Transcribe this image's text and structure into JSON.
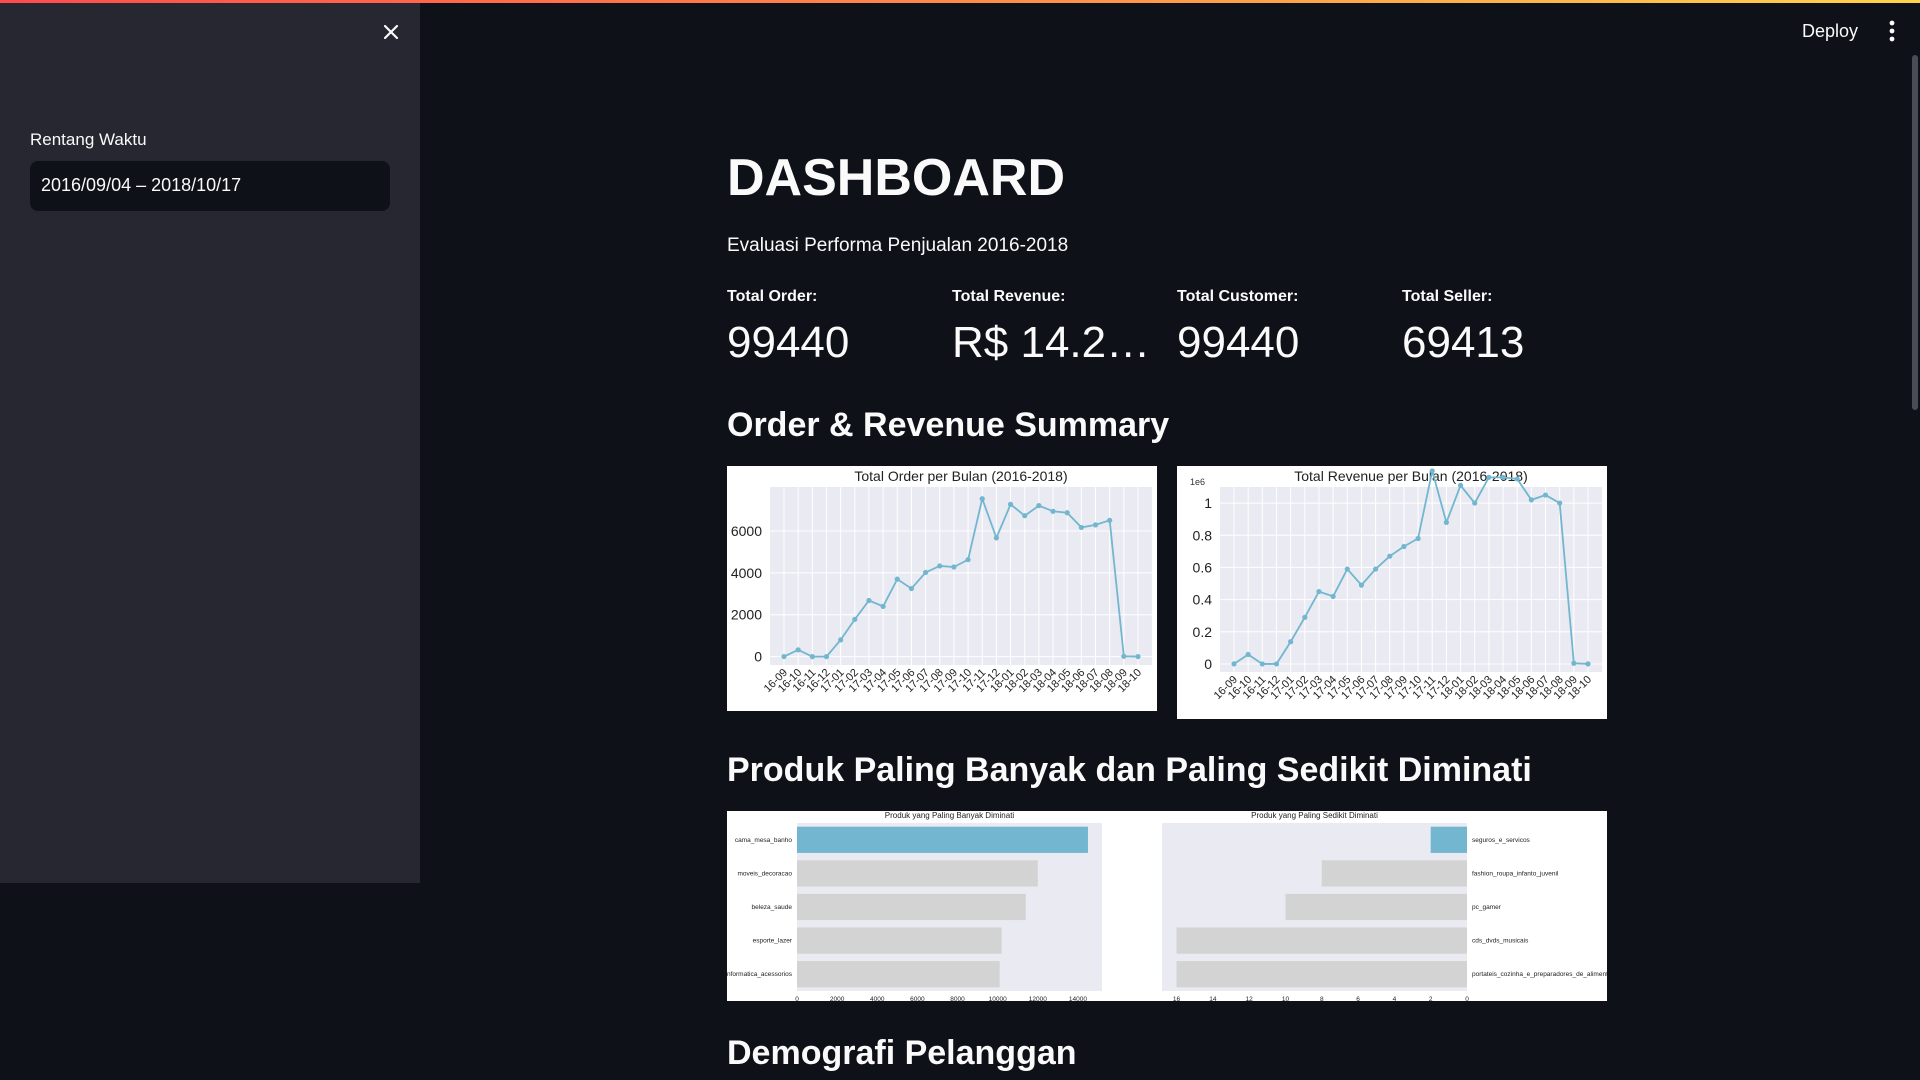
{
  "sidebar": {
    "close_icon": "close-icon",
    "date_label": "Rentang Waktu",
    "date_value": "2016/09/04 – 2018/10/17"
  },
  "header": {
    "deploy_label": "Deploy",
    "menu_icon": "kebab-menu-icon"
  },
  "colors": {
    "accent_gradient": [
      "#ff4b4b",
      "#ffd34b"
    ],
    "series_line": "#72b6cf",
    "bar_highlight": "#72b6cf",
    "bar_muted": "#d3d3d3"
  },
  "main": {
    "title": "DASHBOARD",
    "subtitle": "Evaluasi Performa Penjualan 2016-2018",
    "metrics": [
      {
        "label": "Total Order:",
        "value": "99440"
      },
      {
        "label": "Total Revenue:",
        "value": "R$ 14.20…"
      },
      {
        "label": "Total Customer:",
        "value": "99440"
      },
      {
        "label": "Total Seller:",
        "value": "69413"
      }
    ],
    "section1_title": "Order & Revenue Summary",
    "section2_title": "Produk Paling Banyak dan Paling Sedikit Diminati",
    "section3_title": "Demografi Pelanggan"
  },
  "chart_data": [
    {
      "type": "line",
      "title": "Total Order per Bulan (2016-2018)",
      "x": [
        "16-09",
        "16-10",
        "16-11",
        "16-12",
        "17-01",
        "17-02",
        "17-03",
        "17-04",
        "17-05",
        "17-06",
        "17-07",
        "17-08",
        "17-09",
        "17-10",
        "17-11",
        "17-12",
        "18-01",
        "18-02",
        "18-03",
        "18-04",
        "18-05",
        "18-06",
        "18-07",
        "18-08",
        "18-09",
        "18-10"
      ],
      "values": [
        4,
        324,
        0,
        1,
        800,
        1780,
        2680,
        2400,
        3700,
        3250,
        4020,
        4330,
        4280,
        4630,
        7540,
        5670,
        7270,
        6730,
        7210,
        6940,
        6870,
        6170,
        6290,
        6510,
        16,
        4
      ],
      "yticks": [
        0,
        2000,
        4000,
        6000
      ],
      "ylim": [
        -400,
        8100
      ]
    },
    {
      "type": "line",
      "title": "Total Revenue per Bulan (2016-2018)",
      "scale_label": "1e6",
      "x": [
        "16-09",
        "16-10",
        "16-11",
        "16-12",
        "17-01",
        "17-02",
        "17-03",
        "17-04",
        "17-05",
        "17-06",
        "17-07",
        "17-08",
        "17-09",
        "17-10",
        "17-11",
        "17-12",
        "18-01",
        "18-02",
        "18-03",
        "18-04",
        "18-05",
        "18-06",
        "18-07",
        "18-08",
        "18-09",
        "18-10"
      ],
      "values": [
        0.0003,
        0.059,
        0,
        2e-05,
        0.138,
        0.29,
        0.45,
        0.42,
        0.59,
        0.49,
        0.59,
        0.67,
        0.73,
        0.78,
        1.2,
        0.88,
        1.11,
        1.0,
        1.16,
        1.16,
        1.15,
        1.02,
        1.05,
        1.0,
        0.0045,
        0.0006
      ],
      "values_note_removed": true,
      "yticks": [
        0.0,
        0.2,
        0.4,
        0.6,
        0.8,
        1.0
      ],
      "ylim": [
        -0.05,
        1.1
      ]
    },
    {
      "type": "bar",
      "orientation": "horizontal",
      "title": "Produk yang Paling Banyak Diminati",
      "categories": [
        "cama_mesa_banho",
        "moveis_decoracao",
        "beleza_saude",
        "esporte_lazer",
        "informatica_acessorios"
      ],
      "values": [
        14500,
        12000,
        11400,
        10200,
        10100
      ],
      "xticks": [
        0,
        2000,
        4000,
        6000,
        8000,
        10000,
        12000,
        14000
      ],
      "xlim": [
        0,
        15200
      ]
    },
    {
      "type": "bar",
      "orientation": "horizontal",
      "title": "Produk yang Paling Sedikit Diminati",
      "categories": [
        "seguros_e_servicos",
        "fashion_roupa_infanto_juvenil",
        "pc_gamer",
        "cds_dvds_musicais",
        "portateis_cozinha_e_preparadores_de_alimentos"
      ],
      "values": [
        2,
        8,
        10,
        16,
        16
      ],
      "xticks": [
        16,
        14,
        12,
        10,
        8,
        6,
        4,
        2,
        0
      ],
      "xlim": [
        16.8,
        0
      ],
      "xaxis": "inverted",
      "yaxis_position": "right"
    }
  ]
}
